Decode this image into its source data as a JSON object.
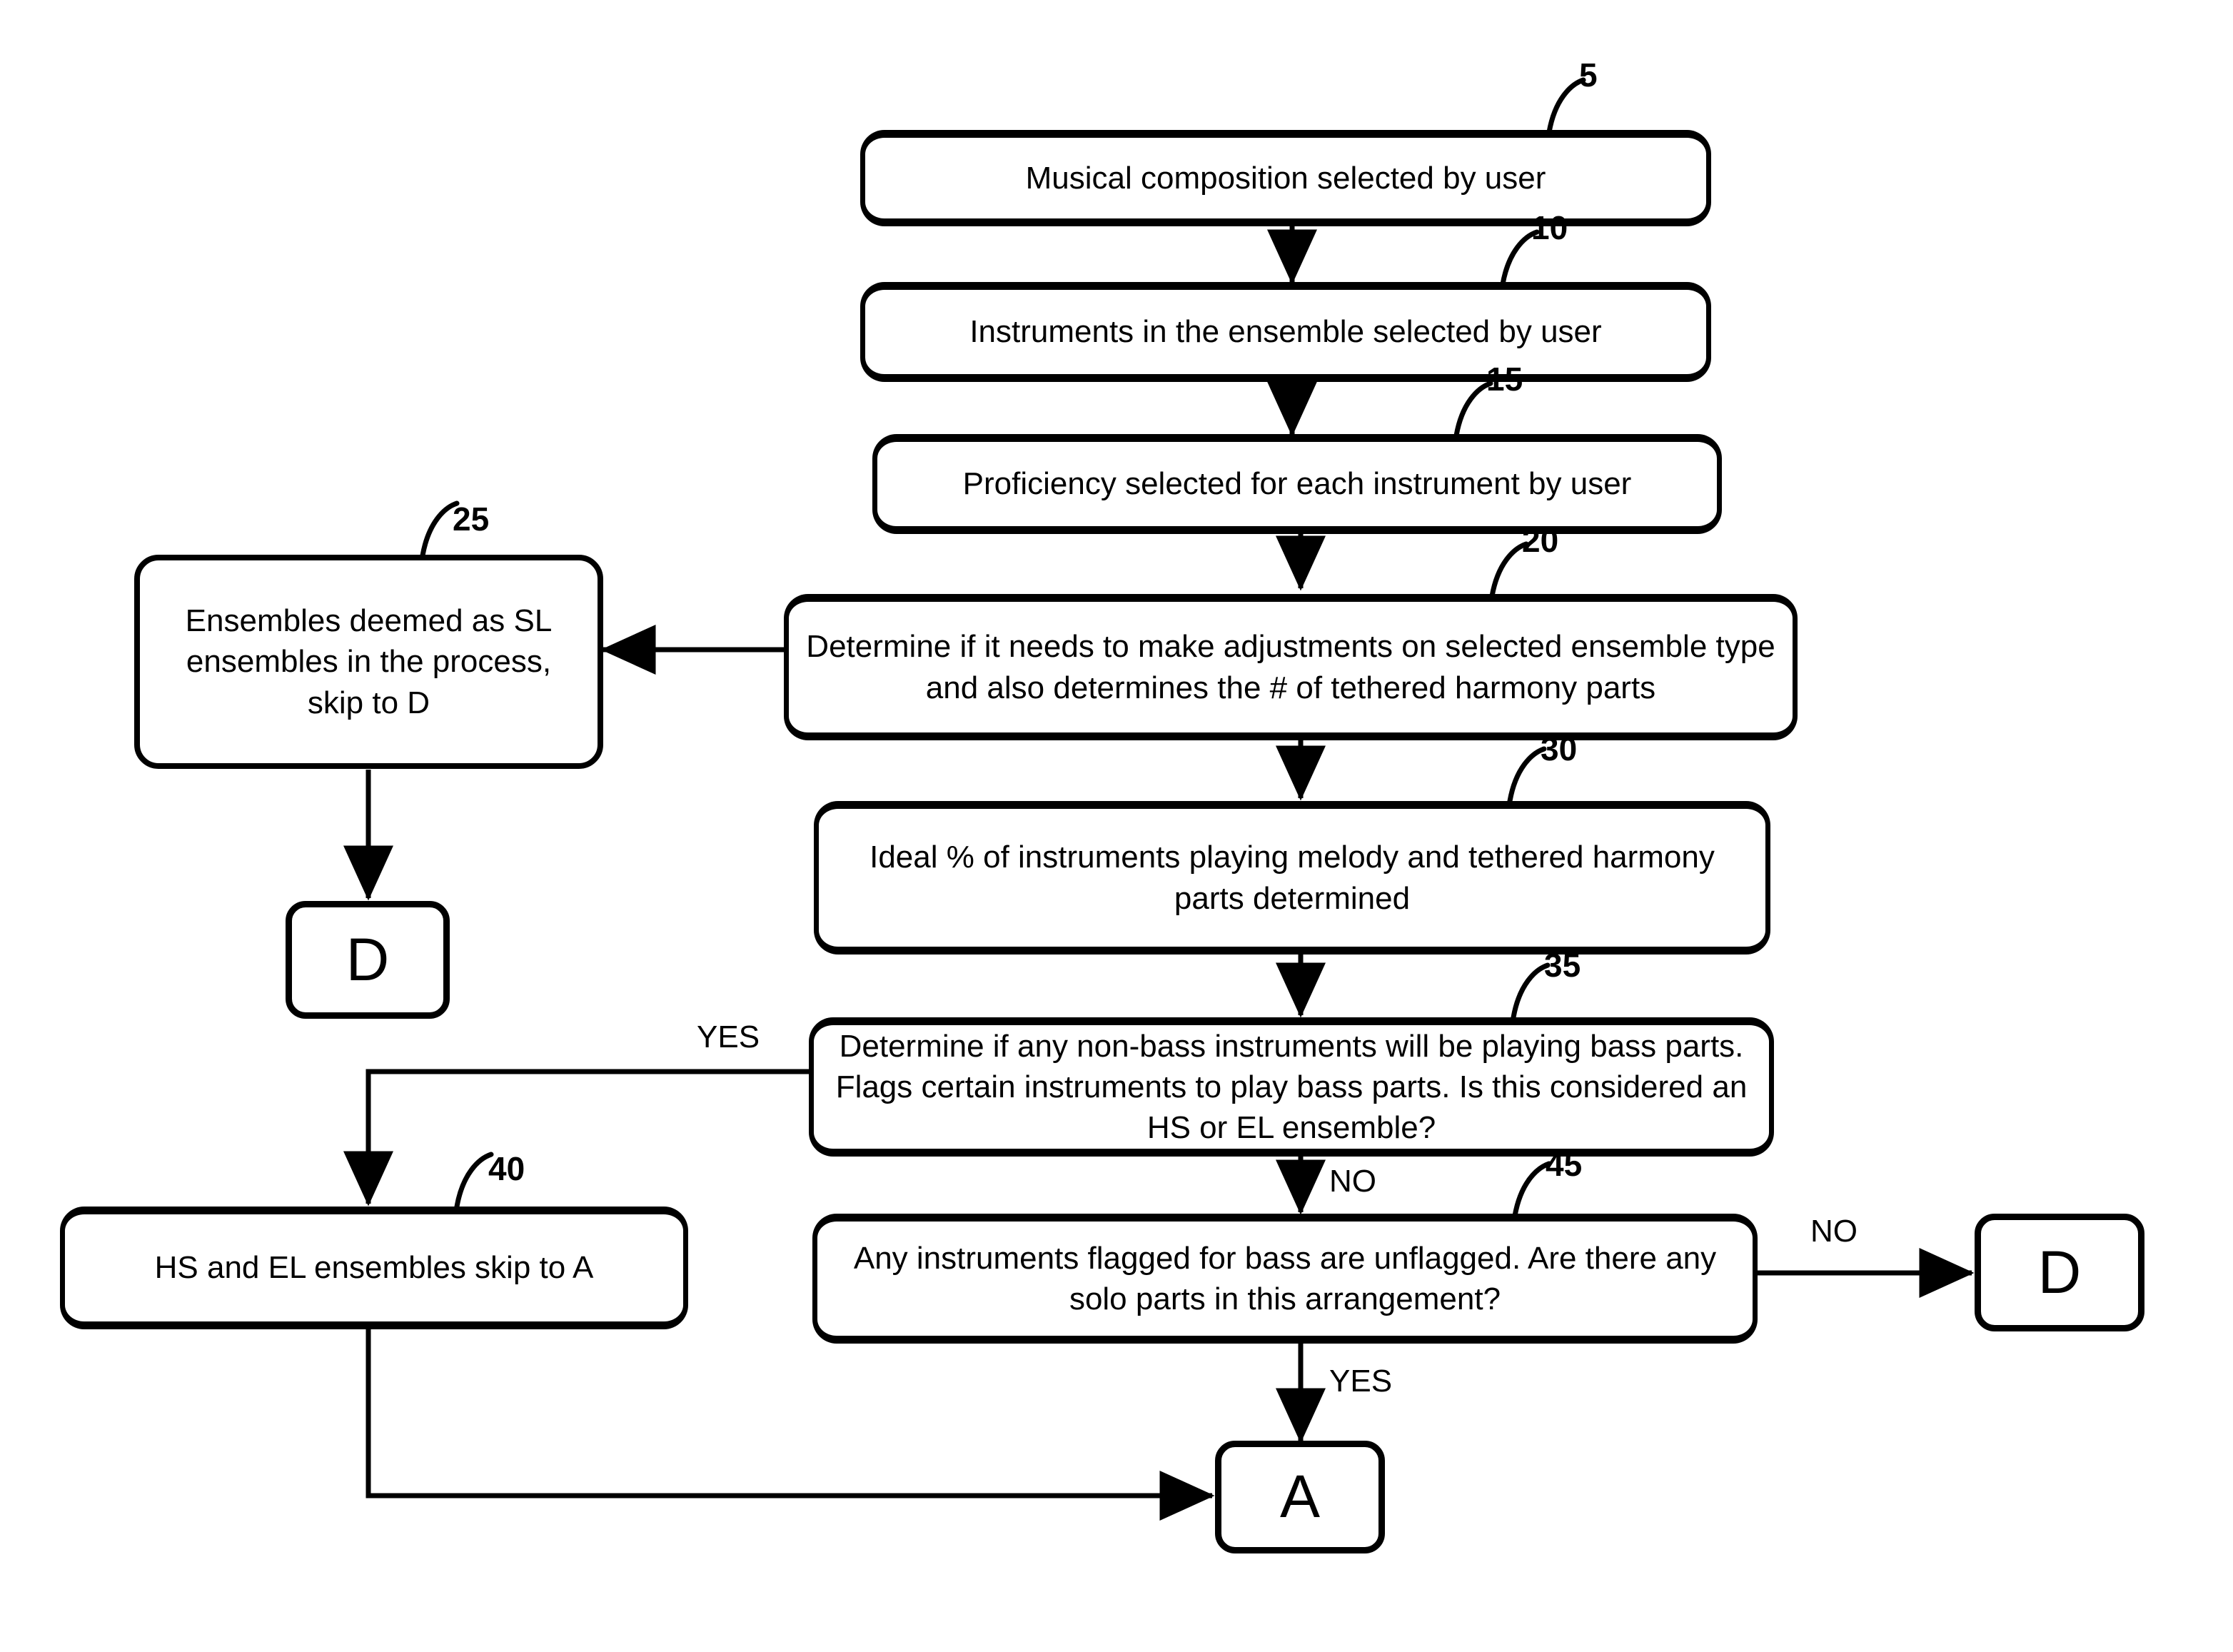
{
  "figure": {
    "title": "Musical arrangement generation flowchart",
    "background_color": "#ffffff",
    "line_color": "#000000"
  },
  "nodes": {
    "n5": {
      "ref": "5",
      "text": "Musical composition selected by user"
    },
    "n10": {
      "ref": "10",
      "text": "Instruments in the ensemble selected by user"
    },
    "n15": {
      "ref": "15",
      "text": "Proficiency selected for each instrument by user"
    },
    "n20": {
      "ref": "20",
      "text": "Determine if it needs to make adjustments on selected ensemble type and also determines the # of tethered harmony parts"
    },
    "n25": {
      "ref": "25",
      "text": "Ensembles deemed as SL ensembles in the process, skip to D"
    },
    "n30": {
      "ref": "30",
      "text": "Ideal % of instruments playing melody and tethered harmony parts determined"
    },
    "n35": {
      "ref": "35",
      "text": "Determine if any non-bass instruments will be playing bass parts.  Flags certain instruments to play bass parts.  Is this considered an HS or EL ensemble?"
    },
    "n40": {
      "ref": "40",
      "text": "HS and EL ensembles skip to A"
    },
    "n45": {
      "ref": "45",
      "text": "Any instruments flagged for bass are unflagged.  Are there any solo parts in this arrangement?"
    },
    "connector_d_left": {
      "text": "D"
    },
    "connector_d_right": {
      "text": "D"
    },
    "connector_a": {
      "text": "A"
    }
  },
  "edge_labels": {
    "yes_from_35": "YES",
    "no_from_35": "NO",
    "yes_from_45": "YES",
    "no_from_45": "NO"
  }
}
